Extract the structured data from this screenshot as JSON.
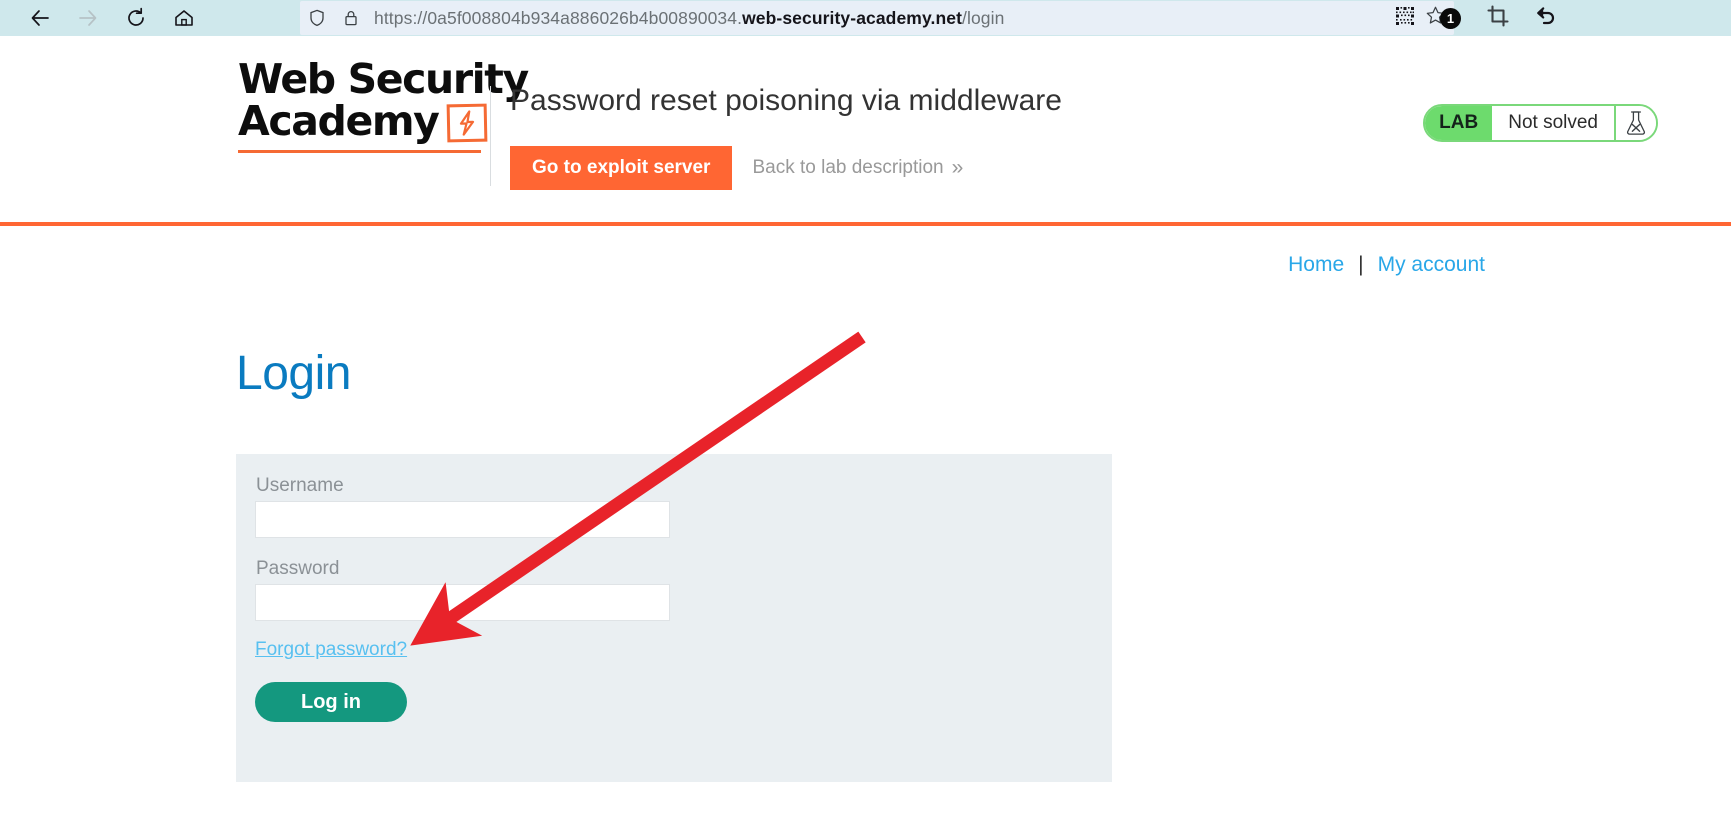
{
  "browser": {
    "back_icon": "back-arrow-icon",
    "forward_icon": "forward-arrow-icon",
    "reload_icon": "reload-icon",
    "home_icon": "home-icon",
    "shield_icon": "shield-icon",
    "lock_icon": "padlock-icon",
    "url_scheme": "https://",
    "url_subdomain": "0a5f008804b934a886026b4b00890034.",
    "url_host": "web-security-academy.net",
    "url_path": "/login",
    "qr_icon": "qr-code-icon",
    "bookmark_icon": "star-bookmark-icon",
    "notification_count": "1",
    "screenshot_icon": "crop-screenshot-icon",
    "undo_icon": "undo-arrow-icon"
  },
  "site_header": {
    "logo_line1": "Web Security",
    "logo_line2": "Academy",
    "logo_bolt_icon": "lightning-bolt-icon",
    "lab_title": "Password reset poisoning via middleware",
    "exploit_button": "Go to exploit server",
    "back_to_lab": "Back to lab description",
    "back_chevron": "»",
    "lab_badge_tag": "LAB",
    "lab_badge_state": "Not solved",
    "lab_badge_icon": "flask-not-solved-icon"
  },
  "top_nav": {
    "home": "Home",
    "separator": "|",
    "my_account": "My account"
  },
  "login": {
    "heading": "Login",
    "username_label": "Username",
    "username_value": "",
    "username_placeholder": "",
    "password_label": "Password",
    "password_value": "",
    "password_placeholder": "",
    "forgot_link": "Forgot password?",
    "submit_label": "Log in"
  },
  "annotation": {
    "arrow_color": "#e8232a",
    "arrow_target": "forgot-password-link"
  },
  "colors": {
    "accent_orange": "#ff6633",
    "link_blue": "#29a7e8",
    "heading_blue": "#0a7bc0",
    "button_green": "#14987f",
    "badge_green": "#6ddb6d",
    "panel_grey": "#eaeff2",
    "chrome_blue": "#cfe8ec"
  }
}
